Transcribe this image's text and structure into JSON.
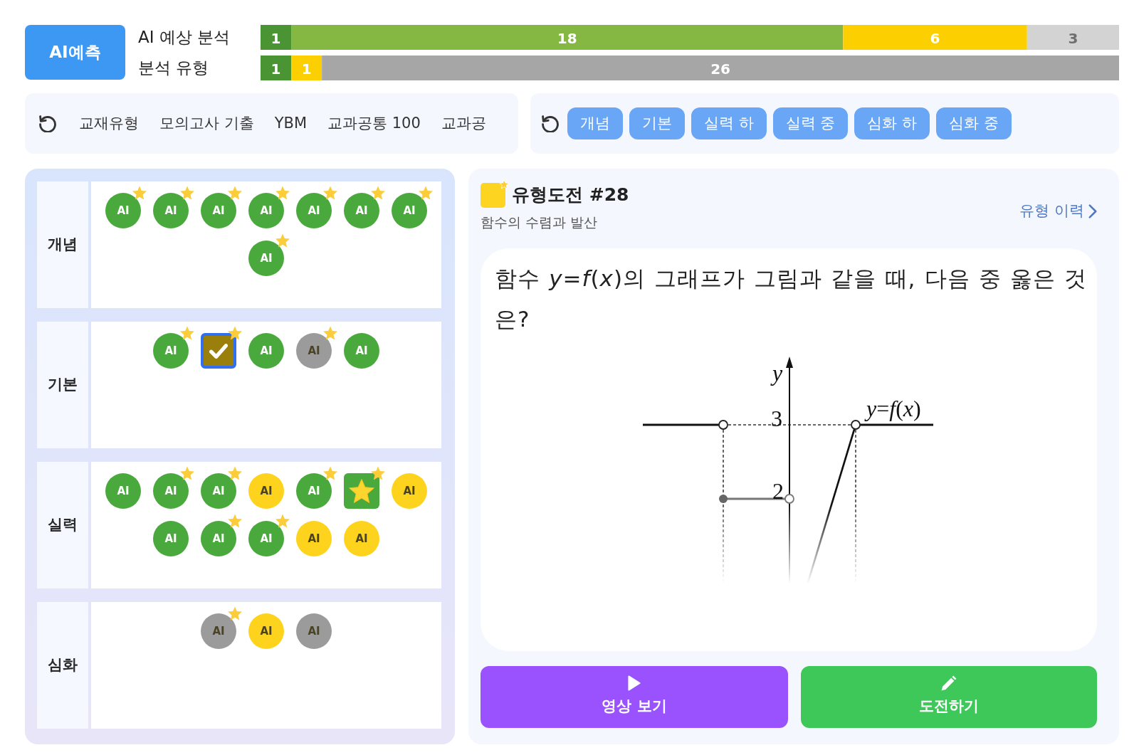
{
  "predict_button": {
    "label": "AI예측"
  },
  "analysis_bars": [
    {
      "chart_data": {
        "type": "bar",
        "orientation": "horizontal",
        "stacked": true,
        "categories": [
          "AI 예상 분석"
        ],
        "series": [
          {
            "color": "#4a9433",
            "values": [
              1
            ]
          },
          {
            "color": "#84b843",
            "values": [
              18
            ]
          },
          {
            "color": "#fcd000",
            "values": [
              6
            ]
          },
          {
            "color": "#d3d3d3",
            "values": [
              3
            ]
          }
        ],
        "data_labels": true,
        "value_labels": [
          "1",
          "18",
          "6",
          "3"
        ]
      }
    },
    {
      "chart_data": {
        "type": "bar",
        "orientation": "horizontal",
        "stacked": true,
        "categories": [
          "분석 유형"
        ],
        "series": [
          {
            "color": "#4a9433",
            "values": [
              1
            ]
          },
          {
            "color": "#fcd000",
            "values": [
              1
            ]
          },
          {
            "color": "#a6a6a6",
            "values": [
              26
            ]
          }
        ],
        "data_labels": true,
        "value_labels": [
          "1",
          "1",
          "26"
        ]
      }
    }
  ],
  "source_filter": {
    "items": [
      "교재유형",
      "모의고사 기출",
      "YBM",
      "교과공통 100",
      "교과공"
    ]
  },
  "level_filter": {
    "chips": [
      {
        "label": "개념",
        "selected": true
      },
      {
        "label": "기본",
        "selected": true
      },
      {
        "label": "실력 하",
        "selected": true
      },
      {
        "label": "실력 중",
        "selected": true
      },
      {
        "label": "심화 하",
        "selected": true
      },
      {
        "label": "심화 중",
        "selected": true
      }
    ]
  },
  "problem_map": {
    "rows": [
      {
        "label": "개념",
        "items": [
          {
            "kind": "ai",
            "label": "AI",
            "color": "#4aa93c",
            "starred": true,
            "selected": false
          },
          {
            "kind": "ai",
            "label": "AI",
            "color": "#4aa93c",
            "starred": true,
            "selected": false
          },
          {
            "kind": "ai",
            "label": "AI",
            "color": "#4aa93c",
            "starred": true,
            "selected": false
          },
          {
            "kind": "ai",
            "label": "AI",
            "color": "#4aa93c",
            "starred": true,
            "selected": false
          },
          {
            "kind": "ai",
            "label": "AI",
            "color": "#4aa93c",
            "starred": true,
            "selected": false
          },
          {
            "kind": "ai",
            "label": "AI",
            "color": "#4aa93c",
            "starred": true,
            "selected": false
          },
          {
            "kind": "ai",
            "label": "AI",
            "color": "#4aa93c",
            "starred": true,
            "selected": false
          },
          {
            "kind": "ai",
            "label": "AI",
            "color": "#4aa93c",
            "starred": true,
            "selected": false
          }
        ]
      },
      {
        "label": "기본",
        "items": [
          {
            "kind": "ai",
            "label": "AI",
            "color": "#4aa93c",
            "starred": true,
            "selected": false
          },
          {
            "kind": "check",
            "color": "#9b7f0c",
            "starred": true,
            "selected": true
          },
          {
            "kind": "ai",
            "label": "AI",
            "color": "#4aa93c",
            "starred": false,
            "selected": false
          },
          {
            "kind": "ai",
            "label": "AI",
            "color": "#9b9b9b",
            "starred": true,
            "selected": false
          },
          {
            "kind": "ai",
            "label": "AI",
            "color": "#4aa93c",
            "starred": false,
            "selected": false
          }
        ]
      },
      {
        "label": "실력",
        "items": [
          {
            "kind": "ai",
            "label": "AI",
            "color": "#4aa93c",
            "starred": false,
            "selected": false
          },
          {
            "kind": "ai",
            "label": "AI",
            "color": "#4aa93c",
            "starred": true,
            "selected": false
          },
          {
            "kind": "ai",
            "label": "AI",
            "color": "#4aa93c",
            "starred": true,
            "selected": false
          },
          {
            "kind": "ai",
            "label": "AI",
            "color": "#fdd31e",
            "starred": false,
            "selected": false
          },
          {
            "kind": "ai",
            "label": "AI",
            "color": "#4aa93c",
            "starred": true,
            "selected": false
          },
          {
            "kind": "star",
            "color": "#4aa93c",
            "starred": true,
            "selected": false
          },
          {
            "kind": "ai",
            "label": "AI",
            "color": "#fdd31e",
            "starred": false,
            "selected": false
          },
          {
            "kind": "ai",
            "label": "AI",
            "color": "#4aa93c",
            "starred": false,
            "selected": false
          },
          {
            "kind": "ai",
            "label": "AI",
            "color": "#4aa93c",
            "starred": true,
            "selected": false
          },
          {
            "kind": "ai",
            "label": "AI",
            "color": "#4aa93c",
            "starred": true,
            "selected": false
          },
          {
            "kind": "ai",
            "label": "AI",
            "color": "#fdd31e",
            "starred": false,
            "selected": false
          },
          {
            "kind": "ai",
            "label": "AI",
            "color": "#fdd31e",
            "starred": false,
            "selected": false
          }
        ]
      },
      {
        "label": "심화",
        "items": [
          {
            "kind": "ai",
            "label": "AI",
            "color": "#9b9b9b",
            "starred": true,
            "selected": false
          },
          {
            "kind": "ai",
            "label": "AI",
            "color": "#fdd31e",
            "starred": false,
            "selected": false
          },
          {
            "kind": "ai",
            "label": "AI",
            "color": "#9b9b9b",
            "starred": false,
            "selected": false
          }
        ]
      }
    ]
  },
  "problem": {
    "title": "유형도전 #28",
    "subtitle": "함수의 수렴과 발산",
    "history_link": "유형 이력",
    "question": "함수 *y*=*f*(*x*)의 그래프가 그림과 같을 때, 다음 중 옳은 것은?",
    "graph": {
      "axis_label": "y",
      "tick_labels": [
        "3",
        "2"
      ],
      "curve_label": "*y*=*f*(*x*)"
    }
  },
  "actions": [
    {
      "kind": "video",
      "label": "영상 보기"
    },
    {
      "kind": "challenge",
      "label": "도전하기"
    }
  ]
}
